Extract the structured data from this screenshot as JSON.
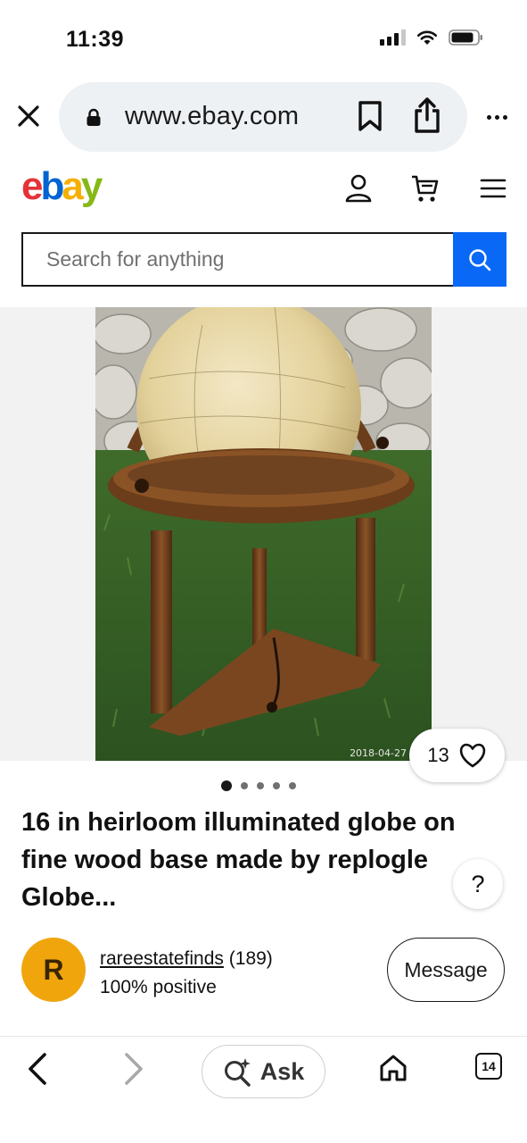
{
  "status_bar": {
    "time": "11:39",
    "icons": [
      "cellular-signal-icon",
      "wifi-icon",
      "battery-icon"
    ]
  },
  "browser": {
    "url": "www.ebay.com",
    "icons": [
      "close-icon",
      "lock-icon",
      "bookmark-icon",
      "share-icon",
      "more-icon"
    ]
  },
  "header": {
    "logo": {
      "e": "e",
      "b": "b",
      "a": "a",
      "y": "y"
    },
    "logo_colors": {
      "e": "#e53238",
      "b": "#0064d2",
      "a": "#f5af02",
      "y": "#86b817"
    },
    "icons": [
      "account-icon",
      "cart-icon",
      "menu-icon"
    ]
  },
  "search": {
    "placeholder": "Search for anything",
    "button_color": "#0968f6",
    "icon": "search-icon"
  },
  "gallery": {
    "photo_date": "2018-04-27",
    "watch_count": "13",
    "image_count": 5,
    "active_image": 1
  },
  "listing": {
    "title": "16 in heirloom illuminated globe on fine wood base made by replogle Globe...",
    "help_label": "?"
  },
  "seller": {
    "initial": "R",
    "name": "rareestatefinds",
    "feedback_count": "(189)",
    "positive": "100% positive",
    "message_label": "Message",
    "avatar_color": "#f0a50d"
  },
  "toolbar": {
    "ask_label": "Ask",
    "tab_count": "14",
    "icons": [
      "back-icon",
      "forward-icon",
      "ask-sparkle-search-icon",
      "home-icon",
      "tabs-icon"
    ]
  }
}
